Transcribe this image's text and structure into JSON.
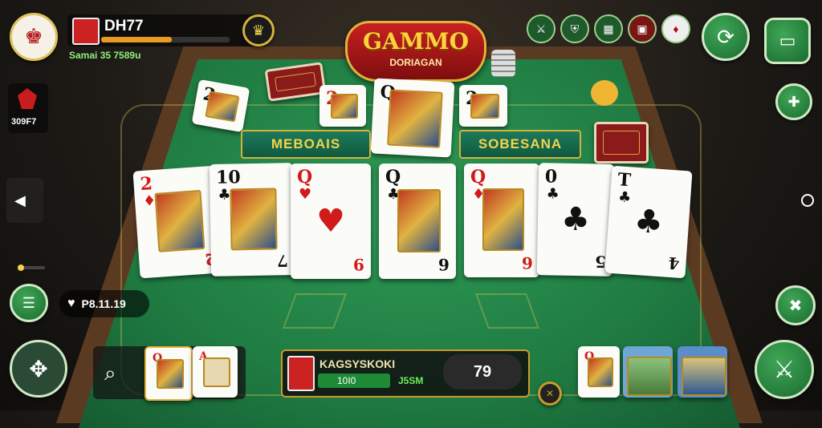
{
  "player": {
    "name": "DH77",
    "sub": "Samai 35 7589u",
    "xp_fraction": 0.55
  },
  "side": {
    "gem_value": "309F7",
    "heart_value": "P8.11.19"
  },
  "logo": {
    "line1": "GAMMO",
    "line2": "DORIAGAN"
  },
  "labels": {
    "left": "MEBOAIS",
    "right": "SOBESANA"
  },
  "table_cards": [
    {
      "rank": "2",
      "suit": "♦",
      "red": true,
      "face": true,
      "brank": "2"
    },
    {
      "rank": "10",
      "suit": "♣",
      "red": false,
      "face": true,
      "brank": "7"
    },
    {
      "rank": "Q",
      "suit": "♥",
      "red": true,
      "face": false,
      "brank": "9"
    },
    {
      "rank": "Q",
      "suit": "♣",
      "red": false,
      "face": true,
      "brank": "6"
    },
    {
      "rank": "Q",
      "suit": "♦",
      "red": true,
      "face": true,
      "brank": "6"
    },
    {
      "rank": "0",
      "suit": "♣",
      "red": false,
      "face": false,
      "brank": "5"
    },
    {
      "rank": "T",
      "suit": "♣",
      "red": false,
      "face": false,
      "brank": "4"
    }
  ],
  "top_cards": [
    {
      "rank": "2",
      "red": false
    },
    {
      "rank": "2",
      "red": true
    },
    {
      "rank": "2",
      "red": false
    }
  ],
  "bottom_panel": {
    "title": "KAGSYSKOKI",
    "bar_value": "10I0",
    "green_value": "J5SM",
    "score": "79"
  },
  "colors": {
    "felt": "#1f7b42",
    "rail": "#5b3a22",
    "accent": "#d4b23c"
  },
  "icons": [
    "king-avatar-icon",
    "crown-icon",
    "gem-icon",
    "left-arrow-icon",
    "menu-icon",
    "heart-icon",
    "dpad-icon",
    "search-icon",
    "settings-icon",
    "chat-icon",
    "puzzle-icon",
    "close-icon",
    "sword-icon",
    "shield-icon",
    "circle-icon"
  ]
}
